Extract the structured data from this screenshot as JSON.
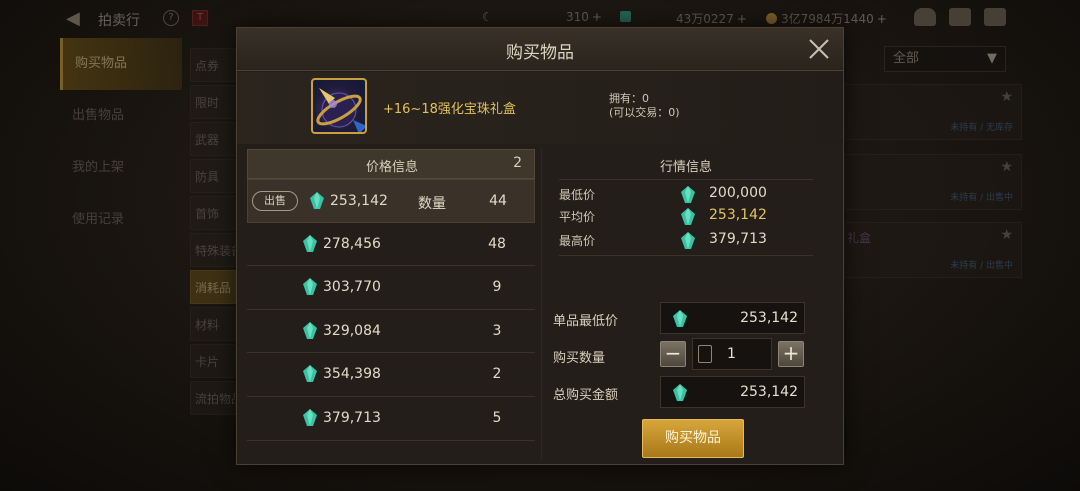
{
  "topbar": {
    "title": "拍卖行",
    "help_label": "?",
    "red_label": "T",
    "moon_amount": "310",
    "gem_amount": "43万0227",
    "gold_amount": "3亿7984万1440",
    "plus": "+"
  },
  "left_nav": {
    "items": [
      {
        "label": "购买物品",
        "active": true
      },
      {
        "label": "出售物品",
        "active": false
      },
      {
        "label": "我的上架",
        "active": false
      },
      {
        "label": "使用记录",
        "active": false
      }
    ]
  },
  "categories": [
    {
      "label": "点券",
      "active": false
    },
    {
      "label": "限时",
      "active": false
    },
    {
      "label": "武器",
      "active": false
    },
    {
      "label": "防具",
      "active": false
    },
    {
      "label": "首饰",
      "active": false
    },
    {
      "label": "特殊装备",
      "active": false
    },
    {
      "label": "消耗品",
      "active": true
    },
    {
      "label": "材料",
      "active": false
    },
    {
      "label": "卡片",
      "active": false
    },
    {
      "label": "流拍物品",
      "active": false
    }
  ],
  "filter": {
    "label": "全部"
  },
  "right_cards": [
    {
      "sub": "未持有 / 无库存",
      "name": ""
    },
    {
      "sub": "未持有 / 出售中",
      "name": ""
    },
    {
      "sub": "未持有 / 出售中",
      "name": "礼盒"
    }
  ],
  "modal": {
    "title": "购买物品",
    "item_name": "+16~18强化宝珠礼盒",
    "owned": "拥有：0",
    "tradable": "(可以交易：0)",
    "price_panel": {
      "title": "价格信息",
      "count": "2",
      "sell_badge": "出售",
      "qty_label": "数量",
      "rows": [
        {
          "price": "253,142",
          "qty": "44"
        },
        {
          "price": "278,456",
          "qty": "48"
        },
        {
          "price": "303,770",
          "qty": "9"
        },
        {
          "price": "329,084",
          "qty": "3"
        },
        {
          "price": "354,398",
          "qty": "2"
        },
        {
          "price": "379,713",
          "qty": "5"
        }
      ]
    },
    "market": {
      "title": "行情信息",
      "min_label": "最低价",
      "min_value": "200,000",
      "avg_label": "平均价",
      "avg_value": "253,142",
      "max_label": "最高价",
      "max_value": "379,713"
    },
    "form": {
      "unit_min_label": "单品最低价",
      "unit_min_value": "253,142",
      "qty_label": "购买数量",
      "qty_value": "1",
      "minus": "−",
      "plus": "+",
      "total_label": "总购买金额",
      "total_value": "253,142"
    },
    "buy_button": "购买物品"
  },
  "colors": {
    "accent_gold": "#c9a03d",
    "avg_price": "#e6c463",
    "gem_teal": "#39c3a4",
    "item_name": "#e3c15b"
  }
}
